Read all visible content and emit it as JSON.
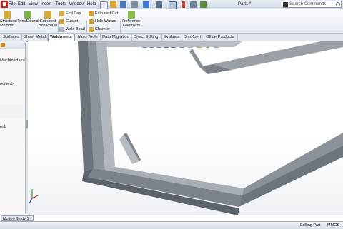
{
  "menu": {
    "items": [
      "File",
      "Edit",
      "View",
      "Insert",
      "Tools",
      "Window",
      "Help"
    ]
  },
  "document_title": "Part1 *",
  "search": {
    "placeholder": "Search Commands"
  },
  "ribbon": {
    "tools": [
      {
        "label": "Structural\nMember"
      },
      {
        "label": "Trim/Extend"
      },
      {
        "label": "Extruded\nBoss/Base"
      },
      {
        "label": "End Cap"
      },
      {
        "label": "Gusset"
      },
      {
        "label": "Weld Bead"
      },
      {
        "label": "Extruded Cut"
      },
      {
        "label": "Hole Wizard"
      },
      {
        "label": "Chamfer"
      },
      {
        "label": "Reference\nGeometry"
      }
    ]
  },
  "tabs": [
    {
      "label": "Surfaces",
      "active": false
    },
    {
      "label": "Sheet Metal",
      "active": false
    },
    {
      "label": "Weldments",
      "active": true
    },
    {
      "label": "Mold Tools",
      "active": false
    },
    {
      "label": "Data Migration",
      "active": false
    },
    {
      "label": "Direct Editing",
      "active": false
    },
    {
      "label": "Evaluate",
      "active": false
    },
    {
      "label": "DimXpert",
      "active": false
    },
    {
      "label": "Office Products",
      "active": false
    }
  ],
  "feature_tree": {
    "items": [
      "Machined><<",
      "ecified>",
      "er1"
    ]
  },
  "status": {
    "motion_tab": "Motion Study 1",
    "mode": "Editing Part",
    "units": "MMGS"
  },
  "colors": {
    "frame_light": "#9aa0a8",
    "frame_dark": "#5f656d",
    "ribbon_bg": "#eef2f7",
    "accent_red": "#c8281e"
  },
  "icons": {
    "logo": "solidworks-logo-icon",
    "search": "search-icon",
    "triad": "axis-triad-icon"
  }
}
